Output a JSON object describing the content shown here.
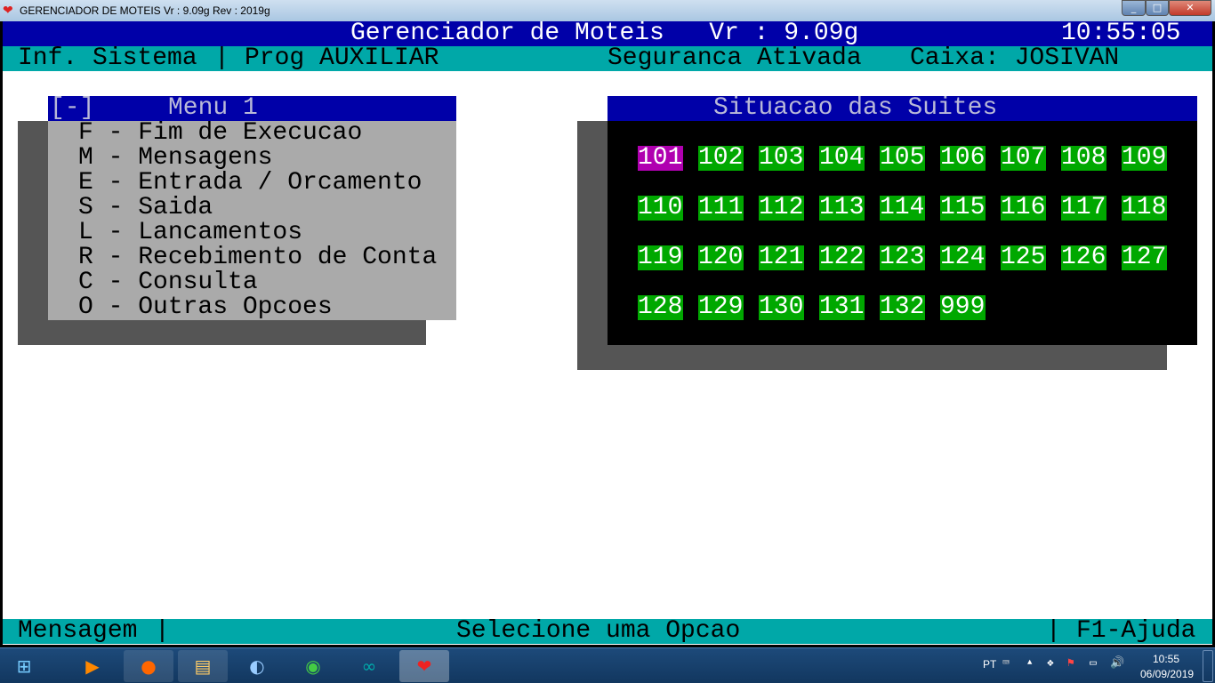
{
  "window": {
    "title": "GERENCIADOR DE MOTEIS  Vr : 9.09g  Rev : 2019g",
    "min": "_",
    "max": "□",
    "close": "✕"
  },
  "header": {
    "app": "Gerenciador de Moteis   Vr : 9.09g",
    "clock": "10:55:05",
    "info": "Inf. Sistema",
    "sep": "|",
    "prog": "Prog AUXILIAR",
    "security": "Seguranca Ativada",
    "caixa": "Caixa: JOSIVAN"
  },
  "menu": {
    "close": "[-]",
    "title": "Menu 1",
    "items": [
      "F - Fim de Execucao",
      "M - Mensagens",
      "E - Entrada / Orcamento",
      "S - Saida",
      "L - Lancamentos",
      "R - Recebimento de Conta",
      "C - Consulta",
      "O - Outras Opcoes"
    ]
  },
  "suites": {
    "title": "Situacao das Suites",
    "rooms": [
      "101",
      "102",
      "103",
      "104",
      "105",
      "106",
      "107",
      "108",
      "109",
      "110",
      "111",
      "112",
      "113",
      "114",
      "115",
      "116",
      "117",
      "118",
      "119",
      "120",
      "121",
      "122",
      "123",
      "124",
      "125",
      "126",
      "127",
      "128",
      "129",
      "130",
      "131",
      "132",
      "999"
    ],
    "selected": "101",
    "colors": {
      "free": "#00a800",
      "selected": "#b000b0"
    }
  },
  "status": {
    "label": "Mensagem",
    "message": "Selecione uma Opcao",
    "help": "F1-Ajuda"
  },
  "taskbar": {
    "lang": "PT",
    "time": "10:55",
    "date": "06/09/2019"
  }
}
